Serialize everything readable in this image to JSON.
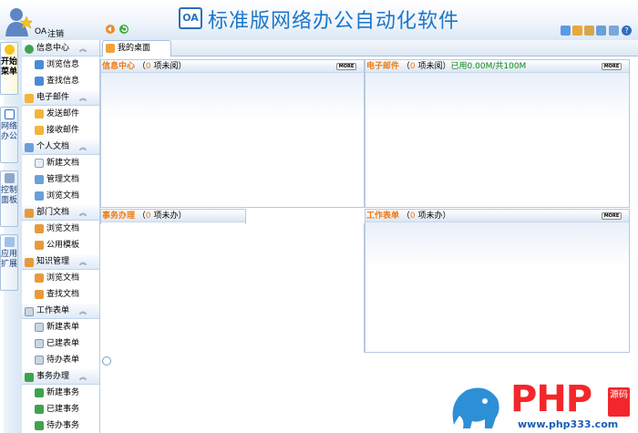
{
  "header": {
    "title": "标准版网络办公自动化软件",
    "logo_text": "OA",
    "user_name": "OA",
    "logout_label": "注销"
  },
  "vtabs": [
    {
      "label": "开始菜单",
      "icon": "lightbulb-icon"
    },
    {
      "label": "网络办公",
      "icon": "oa-icon"
    },
    {
      "label": "控制面板",
      "icon": "wrench-icon"
    },
    {
      "label": "应用扩展",
      "icon": "star-icon"
    }
  ],
  "sidebar": {
    "sections": [
      {
        "label": "信息中心",
        "items": [
          "浏览信息",
          "查找信息"
        ]
      },
      {
        "label": "电子邮件",
        "items": [
          "发送邮件",
          "接收邮件"
        ]
      },
      {
        "label": "个人文档",
        "items": [
          "新建文档",
          "管理文档",
          "浏览文档"
        ]
      },
      {
        "label": "部门文档",
        "items": [
          "浏览文档",
          "公用模板"
        ]
      },
      {
        "label": "知识管理",
        "items": [
          "浏览文档",
          "查找文档"
        ]
      },
      {
        "label": "工作表单",
        "items": [
          "新建表单",
          "已建表单",
          "待办表单"
        ]
      },
      {
        "label": "事务办理",
        "items": [
          "新建事务",
          "已建事务",
          "待办事务"
        ]
      }
    ]
  },
  "main": {
    "tab_label": "我的桌面",
    "panels": {
      "info": {
        "title": "信息中心",
        "count": "0",
        "count_suffix": "项未阅）",
        "open": "（",
        "more": "MORE"
      },
      "mail": {
        "title": "电子邮件",
        "count": "0",
        "count_suffix": "项未阅）",
        "open": "（",
        "usage": "已用0.00M/共100M",
        "more": "MORE"
      },
      "affairs": {
        "title": "事务办理",
        "count": "0",
        "count_suffix": "项未办）",
        "open": "（"
      },
      "forms": {
        "title": "工作表单",
        "count": "0",
        "count_suffix": "项未办）",
        "open": "（",
        "more": "MORE"
      }
    }
  },
  "watermark": {
    "brand": "PHP",
    "badge": "源码",
    "url": "www.php333.com"
  },
  "colors": {
    "title_blue": "#1b76c9",
    "panel_title_orange": "#ee7a14",
    "usage_green": "#0a8a18",
    "watermark_red": "#f3272b"
  }
}
